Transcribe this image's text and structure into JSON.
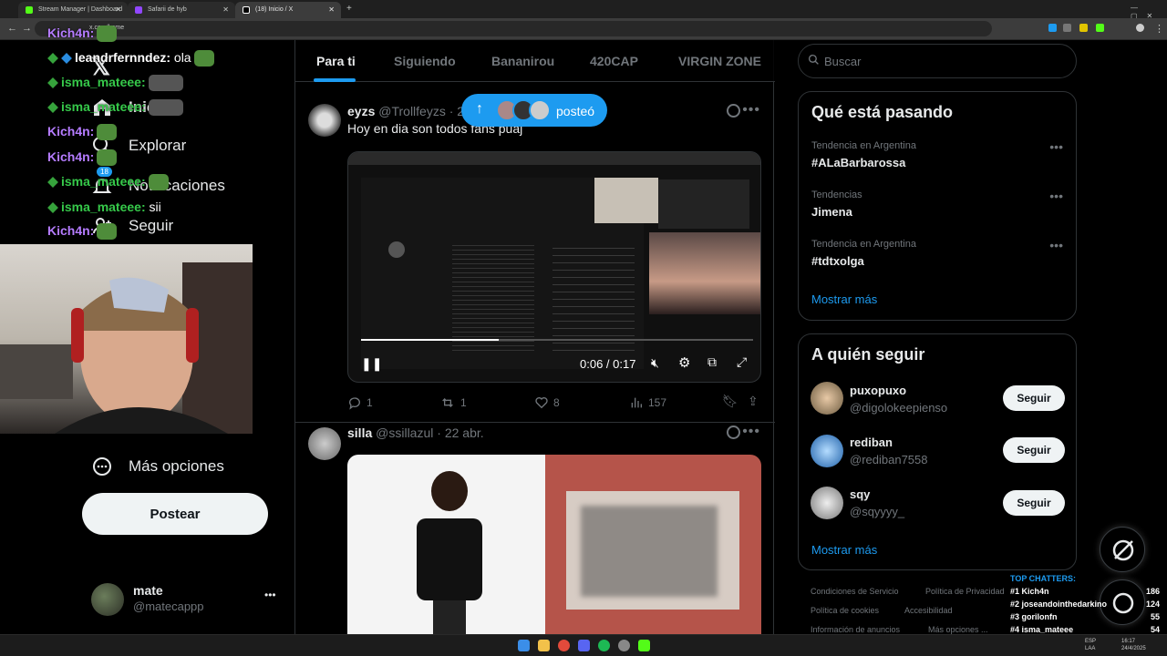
{
  "browser": {
    "tabs": [
      {
        "label": "Stream Manager | Dashboard",
        "active": false
      },
      {
        "label": "1337Adonai",
        "active": false
      },
      {
        "label": "Safarii de hyb",
        "active": false
      },
      {
        "label": "(18) Inicio / X",
        "active": true
      }
    ],
    "url": "x.com/home",
    "new_tab": "+"
  },
  "chat": {
    "lines": [
      {
        "user": "Kich4n:",
        "msg": "",
        "color": "#b57cff"
      },
      {
        "user": "leandrfernndez:",
        "msg": "ola",
        "color": "#ffffff"
      },
      {
        "user": "isma_mateee:",
        "msg": "",
        "color": "#36c94a"
      },
      {
        "user": "isma_mateee:",
        "msg": "",
        "color": "#36c94a"
      },
      {
        "user": "Kich4n:",
        "msg": "",
        "color": "#b57cff"
      },
      {
        "user": "Kich4n:",
        "msg": "",
        "color": "#b57cff"
      },
      {
        "user": "isma_mateee:",
        "msg": "",
        "color": "#36c94a"
      },
      {
        "user": "isma_mateee:",
        "msg": "sii",
        "color": "#36c94a"
      },
      {
        "user": "Kich4n:",
        "msg": "",
        "color": "#b57cff"
      }
    ]
  },
  "sidebar": {
    "items": [
      {
        "label": "Inicio",
        "icon": "home-icon"
      },
      {
        "label": "Explorar",
        "icon": "search-icon"
      },
      {
        "label": "Notificaciones",
        "icon": "bell-icon",
        "badge": "18"
      },
      {
        "label": "Seguir",
        "icon": "follow-icon"
      },
      {
        "label": "Más opciones",
        "icon": "more-circle-icon"
      }
    ],
    "post_button": "Postear",
    "profile": {
      "name": "mate",
      "handle": "@matecappp",
      "more": "•••"
    }
  },
  "feed": {
    "tabs": [
      "Para ti",
      "Siguiendo",
      "Bananirou",
      "420CAP",
      "VIRGIN ZONE"
    ],
    "new_posts_label": "posteó",
    "posts": [
      {
        "name": "eyzs",
        "handle": "@Trollfeyzs",
        "time": "· 23",
        "text": "Hoy en dia son todos fans puaj",
        "video_time": "0:06 / 0:17",
        "replies": "1",
        "reposts": "1",
        "likes": "8",
        "views": "157"
      },
      {
        "name": "silla",
        "handle": "@ssillazul",
        "time": "· 22 abr."
      }
    ]
  },
  "right": {
    "search_placeholder": "Buscar",
    "trends_title": "Qué está pasando",
    "trends": [
      {
        "meta": "Tendencia en Argentina",
        "name": "#ALaBarbarossa"
      },
      {
        "meta": "Tendencias",
        "name": "Jimena"
      },
      {
        "meta": "Tendencia en Argentina",
        "name": "#tdtxolga"
      }
    ],
    "show_more": "Mostrar más",
    "follow_title": "A quién seguir",
    "follow": [
      {
        "name": "puxopuxo",
        "handle": "@digolokeepienso",
        "button": "Seguir"
      },
      {
        "name": "rediban",
        "handle": "@rediban7558",
        "button": "Seguir"
      },
      {
        "name": "sqy",
        "handle": "@sqyyyy_",
        "button": "Seguir"
      }
    ],
    "footer": [
      "Condiciones de Servicio",
      "Política de Privacidad",
      "Política de cookies",
      "Accesibilidad",
      "Información de anuncios",
      "Más opciones ..."
    ]
  },
  "top_chatters": {
    "title": "TOP CHATTERS:",
    "rows": [
      {
        "rank": "#1",
        "name": "Kich4n",
        "count": "186"
      },
      {
        "rank": "#2",
        "name": "joseandointhedarkino",
        "count": "124"
      },
      {
        "rank": "#3",
        "name": "gorilonfn",
        "count": "55"
      },
      {
        "rank": "#4",
        "name": "isma_mateee",
        "count": "54"
      },
      {
        "rank": "#5",
        "name": "santizaza5",
        "count": "34"
      }
    ]
  },
  "taskbar": {
    "lang": "ESP\nLAA",
    "clock": "16:17\n24/4/2025"
  },
  "colors": {
    "accent": "#1d9bf0",
    "border": "#2f3336",
    "muted": "#71767b"
  }
}
